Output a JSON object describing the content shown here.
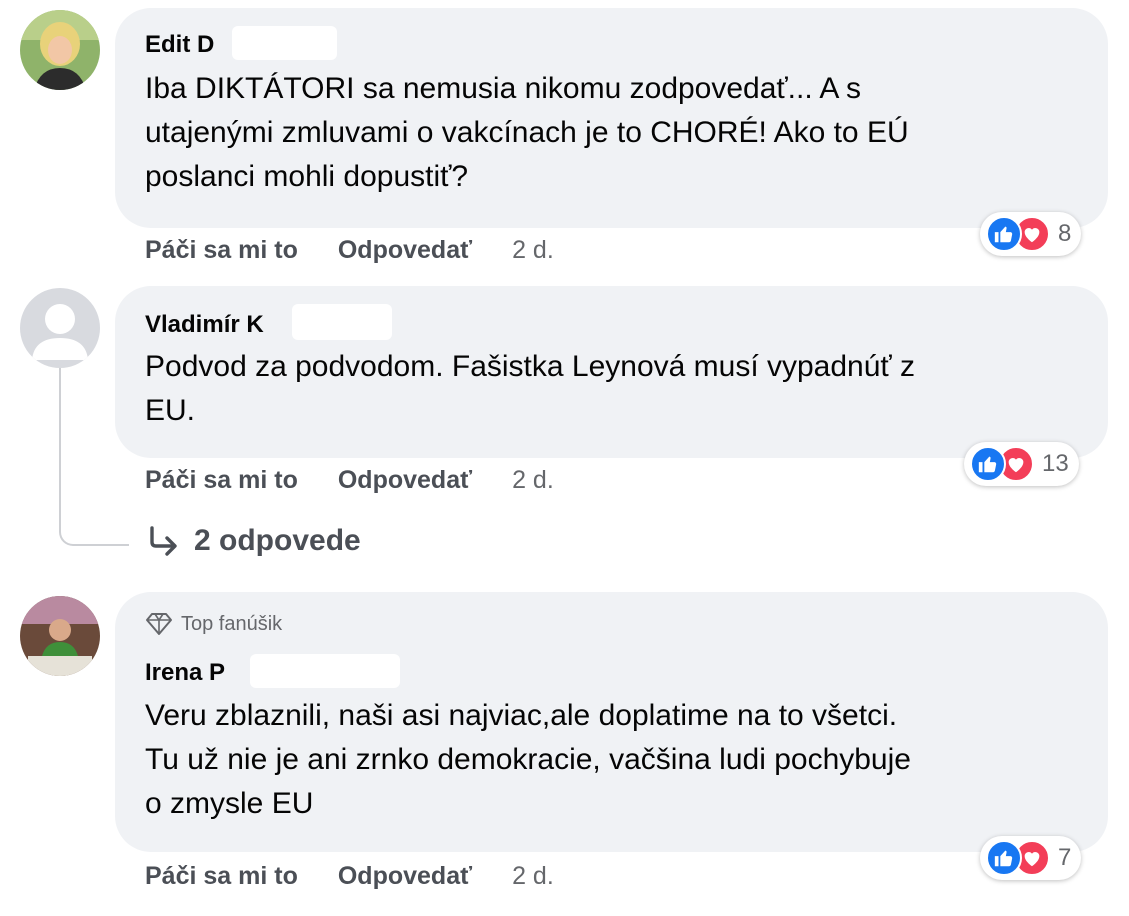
{
  "comments": [
    {
      "author": "Edit D",
      "lines": [
        "Iba DIKTÁTORI sa nemusia nikomu zodpovedať... A s",
        "utajenými zmluvami o vakcínach je to CHORÉ! Ako to EÚ",
        "poslanci mohli dopustiť?"
      ],
      "like_label": "Páči sa mi to",
      "reply_label": "Odpovedať",
      "time": "2 d.",
      "reaction_icons": [
        "like-icon",
        "love-icon"
      ],
      "reaction_count": "8"
    },
    {
      "author": "Vladimír K",
      "lines": [
        "Podvod za podvodom. Fašistka Leynová musí vypadnúť z",
        "EU."
      ],
      "like_label": "Páči sa mi to",
      "reply_label": "Odpovedať",
      "time": "2 d.",
      "reaction_icons": [
        "like-icon",
        "love-icon"
      ],
      "reaction_count": "13",
      "replies_link": "2 odpovede"
    },
    {
      "badge": "Top fanúšik",
      "author": "Irena P",
      "lines": [
        "Veru zblaznili, naši asi najviac,ale doplatime na to všetci.",
        "Tu už nie je ani zrnko demokracie, vačšina ludi pochybuje",
        "o zmysle EU"
      ],
      "like_label": "Páči sa mi to",
      "reply_label": "Odpovedať",
      "time": "2 d.",
      "reaction_icons": [
        "like-icon",
        "love-icon"
      ],
      "reaction_count": "7"
    }
  ],
  "colors": {
    "bubble": "#f0f2f5",
    "like": "#1877f2",
    "love": "#f33e58",
    "meta_text": "#65676b"
  }
}
